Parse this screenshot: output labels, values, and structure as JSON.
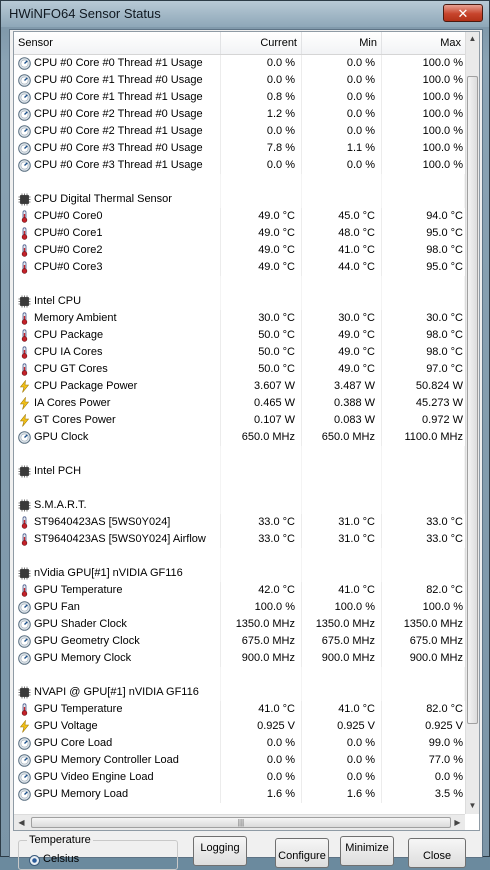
{
  "window": {
    "title": "HWiNFO64 Sensor Status",
    "close_label": "✕"
  },
  "table": {
    "headers": {
      "sensor": "Sensor",
      "current": "Current",
      "min": "Min",
      "max": "Max"
    },
    "rows": [
      {
        "type": "item",
        "icon": "gauge",
        "name": "CPU #0 Core #0 Thread #1 Usage",
        "current": "0.0 %",
        "min": "0.0 %",
        "max": "100.0 %"
      },
      {
        "type": "item",
        "icon": "gauge",
        "name": "CPU #0 Core #1 Thread #0 Usage",
        "current": "0.0 %",
        "min": "0.0 %",
        "max": "100.0 %"
      },
      {
        "type": "item",
        "icon": "gauge",
        "name": "CPU #0 Core #1 Thread #1 Usage",
        "current": "0.8 %",
        "min": "0.0 %",
        "max": "100.0 %"
      },
      {
        "type": "item",
        "icon": "gauge",
        "name": "CPU #0 Core #2 Thread #0 Usage",
        "current": "1.2 %",
        "min": "0.0 %",
        "max": "100.0 %"
      },
      {
        "type": "item",
        "icon": "gauge",
        "name": "CPU #0 Core #2 Thread #1 Usage",
        "current": "0.0 %",
        "min": "0.0 %",
        "max": "100.0 %"
      },
      {
        "type": "item",
        "icon": "gauge",
        "name": "CPU #0 Core #3 Thread #0 Usage",
        "current": "7.8 %",
        "min": "1.1 %",
        "max": "100.0 %"
      },
      {
        "type": "item",
        "icon": "gauge",
        "name": "CPU #0 Core #3 Thread #1 Usage",
        "current": "0.0 %",
        "min": "0.0 %",
        "max": "100.0 %"
      },
      {
        "type": "blank"
      },
      {
        "type": "group",
        "icon": "chip",
        "name": "CPU Digital Thermal Sensor"
      },
      {
        "type": "item",
        "icon": "thermometer",
        "name": "CPU#0 Core0",
        "current": "49.0 °C",
        "min": "45.0 °C",
        "max": "94.0 °C"
      },
      {
        "type": "item",
        "icon": "thermometer",
        "name": "CPU#0 Core1",
        "current": "49.0 °C",
        "min": "48.0 °C",
        "max": "95.0 °C"
      },
      {
        "type": "item",
        "icon": "thermometer",
        "name": "CPU#0 Core2",
        "current": "49.0 °C",
        "min": "41.0 °C",
        "max": "98.0 °C"
      },
      {
        "type": "item",
        "icon": "thermometer",
        "name": "CPU#0 Core3",
        "current": "49.0 °C",
        "min": "44.0 °C",
        "max": "95.0 °C"
      },
      {
        "type": "blank"
      },
      {
        "type": "group",
        "icon": "chip",
        "name": "Intel CPU"
      },
      {
        "type": "item",
        "icon": "thermometer",
        "name": "Memory Ambient",
        "current": "30.0 °C",
        "min": "30.0 °C",
        "max": "30.0 °C"
      },
      {
        "type": "item",
        "icon": "thermometer",
        "name": "CPU Package",
        "current": "50.0 °C",
        "min": "49.0 °C",
        "max": "98.0 °C"
      },
      {
        "type": "item",
        "icon": "thermometer",
        "name": "CPU IA Cores",
        "current": "50.0 °C",
        "min": "49.0 °C",
        "max": "98.0 °C"
      },
      {
        "type": "item",
        "icon": "thermometer",
        "name": "CPU GT Cores",
        "current": "50.0 °C",
        "min": "49.0 °C",
        "max": "97.0 °C"
      },
      {
        "type": "item",
        "icon": "bolt",
        "name": "CPU Package Power",
        "current": "3.607 W",
        "min": "3.487 W",
        "max": "50.824 W"
      },
      {
        "type": "item",
        "icon": "bolt",
        "name": "IA Cores Power",
        "current": "0.465 W",
        "min": "0.388 W",
        "max": "45.273 W"
      },
      {
        "type": "item",
        "icon": "bolt",
        "name": "GT Cores Power",
        "current": "0.107 W",
        "min": "0.083 W",
        "max": "0.972 W"
      },
      {
        "type": "item",
        "icon": "gauge",
        "name": "GPU Clock",
        "current": "650.0 MHz",
        "min": "650.0 MHz",
        "max": "1100.0 MHz"
      },
      {
        "type": "blank"
      },
      {
        "type": "group",
        "icon": "chip",
        "name": "Intel PCH"
      },
      {
        "type": "blank"
      },
      {
        "type": "group",
        "icon": "chip",
        "name": "S.M.A.R.T."
      },
      {
        "type": "item",
        "icon": "thermometer",
        "name": "ST9640423AS [5WS0Y024]",
        "current": "33.0 °C",
        "min": "31.0 °C",
        "max": "33.0 °C"
      },
      {
        "type": "item",
        "icon": "thermometer",
        "name": "ST9640423AS [5WS0Y024] Airflow",
        "current": "33.0 °C",
        "min": "31.0 °C",
        "max": "33.0 °C"
      },
      {
        "type": "blank"
      },
      {
        "type": "group",
        "icon": "chip",
        "name": "nVidia GPU[#1] nVIDIA GF116"
      },
      {
        "type": "item",
        "icon": "thermometer",
        "name": "GPU Temperature",
        "current": "42.0 °C",
        "min": "41.0 °C",
        "max": "82.0 °C"
      },
      {
        "type": "item",
        "icon": "gauge",
        "name": "GPU Fan",
        "current": "100.0 %",
        "min": "100.0 %",
        "max": "100.0 %"
      },
      {
        "type": "item",
        "icon": "gauge",
        "name": "GPU Shader Clock",
        "current": "1350.0 MHz",
        "min": "1350.0 MHz",
        "max": "1350.0 MHz"
      },
      {
        "type": "item",
        "icon": "gauge",
        "name": "GPU Geometry Clock",
        "current": "675.0 MHz",
        "min": "675.0 MHz",
        "max": "675.0 MHz"
      },
      {
        "type": "item",
        "icon": "gauge",
        "name": "GPU Memory Clock",
        "current": "900.0 MHz",
        "min": "900.0 MHz",
        "max": "900.0 MHz"
      },
      {
        "type": "blank"
      },
      {
        "type": "group",
        "icon": "chip",
        "name": "NVAPI @ GPU[#1] nVIDIA GF116"
      },
      {
        "type": "item",
        "icon": "thermometer",
        "name": "GPU Temperature",
        "current": "41.0 °C",
        "min": "41.0 °C",
        "max": "82.0 °C"
      },
      {
        "type": "item",
        "icon": "bolt",
        "name": "GPU Voltage",
        "current": "0.925 V",
        "min": "0.925 V",
        "max": "0.925 V"
      },
      {
        "type": "item",
        "icon": "gauge",
        "name": "GPU Core Load",
        "current": "0.0 %",
        "min": "0.0 %",
        "max": "99.0 %"
      },
      {
        "type": "item",
        "icon": "gauge",
        "name": "GPU Memory Controller Load",
        "current": "0.0 %",
        "min": "0.0 %",
        "max": "77.0 %"
      },
      {
        "type": "item",
        "icon": "gauge",
        "name": "GPU Video Engine Load",
        "current": "0.0 %",
        "min": "0.0 %",
        "max": "0.0 %"
      },
      {
        "type": "item",
        "icon": "gauge",
        "name": "GPU Memory Load",
        "current": "1.6 %",
        "min": "1.6 %",
        "max": "3.5 %"
      }
    ]
  },
  "bottom": {
    "temperature_group_label": "Temperature",
    "celsius_label": "Celsius",
    "logging_label": "Logging",
    "configure_label": "Configure",
    "minimize_label": "Minimize",
    "close_label": "Close"
  }
}
